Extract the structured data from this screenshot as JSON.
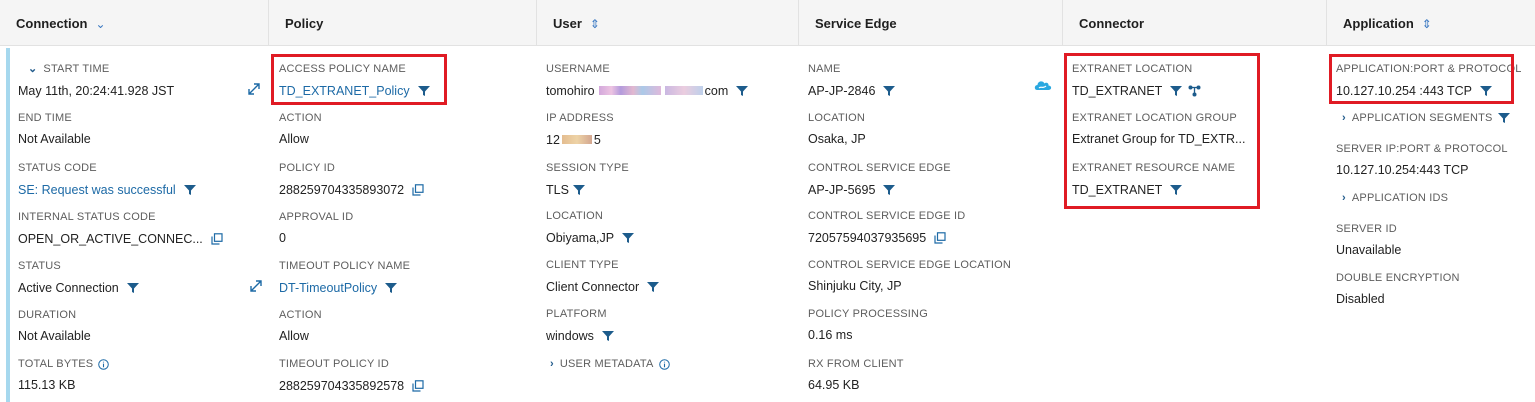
{
  "headers": {
    "connection": "Connection",
    "policy": "Policy",
    "user": "User",
    "service_edge": "Service Edge",
    "connector": "Connector",
    "application": "Application"
  },
  "connection": {
    "start_time_label": "START TIME",
    "start_time": "May 11th, 20:24:41.928 JST",
    "end_time_label": "END TIME",
    "end_time": "Not Available",
    "status_code_label": "STATUS CODE",
    "status_code": "SE: Request was successful",
    "internal_status_code_label": "INTERNAL STATUS CODE",
    "internal_status_code": "OPEN_OR_ACTIVE_CONNEC...",
    "status_label": "STATUS",
    "status": "Active Connection",
    "duration_label": "DURATION",
    "duration": "Not Available",
    "total_bytes_label": "TOTAL BYTES",
    "total_bytes": "115.13 KB"
  },
  "policy": {
    "access_policy_name_label": "ACCESS POLICY NAME",
    "access_policy_name": "TD_EXTRANET_Policy",
    "action_label": "ACTION",
    "action": "Allow",
    "policy_id_label": "POLICY ID",
    "policy_id": "288259704335893072",
    "approval_id_label": "APPROVAL ID",
    "approval_id": "0",
    "timeout_policy_name_label": "TIMEOUT POLICY NAME",
    "timeout_policy_name": "DT-TimeoutPolicy",
    "action2_label": "ACTION",
    "action2": "Allow",
    "timeout_policy_id_label": "TIMEOUT POLICY ID",
    "timeout_policy_id": "288259704335892578"
  },
  "user": {
    "username_label": "USERNAME",
    "username_prefix": "tomohiro",
    "username_suffix": "com",
    "ip_address_label": "IP ADDRESS",
    "ip_prefix": "12",
    "ip_suffix": "5",
    "session_type_label": "SESSION TYPE",
    "session_type": "TLS",
    "location_label": "LOCATION",
    "location": "Obiyama,JP",
    "client_type_label": "CLIENT TYPE",
    "client_type": "Client Connector",
    "platform_label": "PLATFORM",
    "platform": "windows",
    "user_metadata_label": "USER METADATA"
  },
  "service_edge": {
    "name_label": "NAME",
    "name": "AP-JP-2846",
    "location_label": "LOCATION",
    "location": "Osaka, JP",
    "control_service_edge_label": "CONTROL SERVICE EDGE",
    "control_service_edge": "AP-JP-5695",
    "control_service_edge_id_label": "CONTROL SERVICE EDGE ID",
    "control_service_edge_id": "72057594037935695",
    "control_service_edge_location_label": "CONTROL SERVICE EDGE LOCATION",
    "control_service_edge_location": "Shinjuku City, JP",
    "policy_processing_label": "POLICY PROCESSING",
    "policy_processing": "0.16 ms",
    "rx_from_client_label": "RX FROM CLIENT",
    "rx_from_client": "64.95 KB"
  },
  "connector": {
    "extranet_location_label": "EXTRANET LOCATION",
    "extranet_location": "TD_EXTRANET",
    "extranet_location_group_label": "EXTRANET LOCATION GROUP",
    "extranet_location_group": "Extranet Group for TD_EXTR...",
    "extranet_resource_name_label": "EXTRANET RESOURCE NAME",
    "extranet_resource_name": "TD_EXTRANET"
  },
  "application": {
    "port_protocol_label": "APPLICATION:PORT & PROTOCOL",
    "port_protocol": "10.127.10.254 :443 TCP",
    "segments_label": "APPLICATION SEGMENTS",
    "server_ip_label": "SERVER IP:PORT & PROTOCOL",
    "server_ip": "10.127.10.254:443 TCP",
    "app_ids_label": "APPLICATION IDS",
    "server_id_label": "SERVER ID",
    "server_id": "Unavailable",
    "double_encryption_label": "DOUBLE ENCRYPTION",
    "double_encryption": "Disabled"
  },
  "colors": {
    "accent": "#a6d8ee",
    "link": "#1d6aa6",
    "filter_icon": "#1d5c8c",
    "highlight_box": "#e01b24"
  }
}
